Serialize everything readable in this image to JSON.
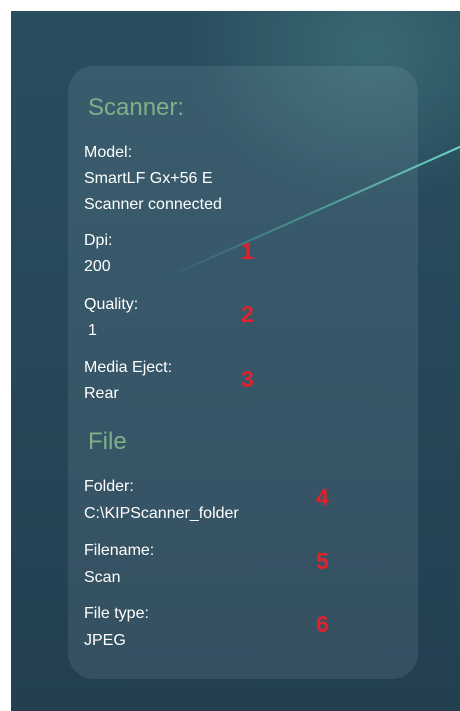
{
  "scanner": {
    "title": "Scanner:",
    "model_label": "Model:",
    "model_value": "SmartLF Gx+56 E",
    "status": "Scanner connected",
    "dpi_label": "Dpi:",
    "dpi_value": "200",
    "quality_label": "Quality:",
    "quality_value": "1",
    "media_eject_label": "Media Eject:",
    "media_eject_value": "Rear"
  },
  "file": {
    "title": "File",
    "folder_label": "Folder:",
    "folder_value": "C:\\KIPScanner_folder",
    "filename_label": "Filename:",
    "filename_value": "Scan",
    "file_type_label": "File type:",
    "file_type_value": "JPEG"
  },
  "markers": [
    "1",
    "2",
    "3",
    "4",
    "5",
    "6"
  ],
  "colors": {
    "section_title": "#7fb08a",
    "marker": "#e0222d",
    "text": "#ffffff"
  }
}
